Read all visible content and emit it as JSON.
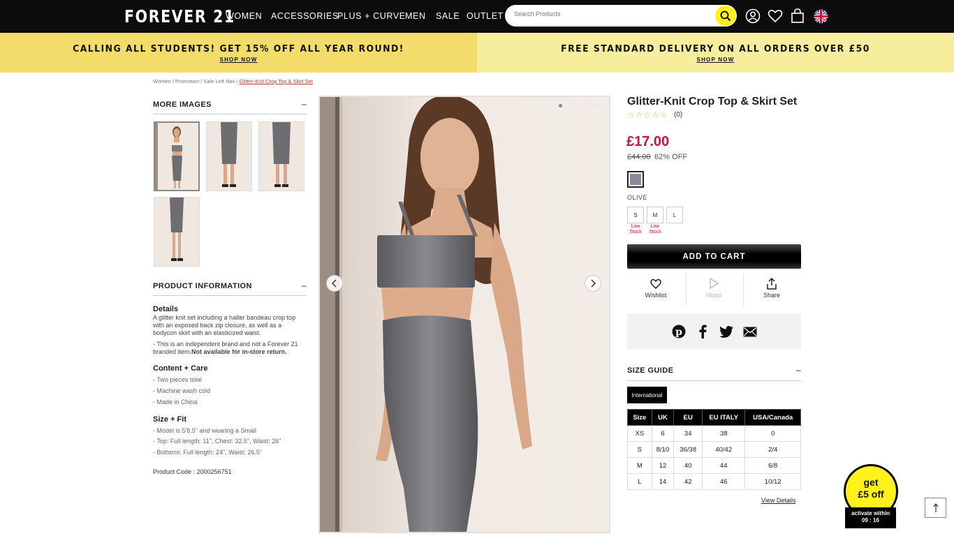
{
  "header": {
    "logo": "FOREVER 21",
    "nav": [
      "WOMEN",
      "ACCESSORIES",
      "PLUS + CURVE",
      "MEN",
      "SALE",
      "OUTLET"
    ],
    "search_placeholder": "Search Products",
    "icons": [
      "search-icon",
      "account-icon",
      "wishlist-heart-icon",
      "shopping-bag-icon",
      "uk-flag-icon"
    ]
  },
  "promos": [
    {
      "text": "CALLING ALL STUDENTS! GET 15% OFF ALL YEAR ROUND!",
      "link": "SHOP NOW",
      "bg": "#f3dc6a"
    },
    {
      "text": "FREE STANDARD DELIVERY ON ALL ORDERS OVER £50",
      "link": "SHOP NOW",
      "bg": "#f6ee9d"
    }
  ],
  "breadcrumb": {
    "path": "Women / Promotion / Sale Left Nav / ",
    "current": "Glitter-Knit Crop Top & Skirt Set"
  },
  "more_images": {
    "title": "MORE IMAGES",
    "toggle": "–"
  },
  "product_info": {
    "title": "PRODUCT INFORMATION",
    "toggle": "–",
    "details_title": "Details",
    "details_text": "A glitter knit set including a halter bandeau crop top with an exposed back zip closure, as well as a bodycon skirt with an elasticized waist.",
    "details_note": "- This is an independent brand and not a Forever 21 branded item.",
    "details_note_bold": "Not available for in-store return.",
    "care_title": "Content + Care",
    "care": [
      "- Two pieces total",
      "- Machine wash cold",
      "- Made in China"
    ],
    "fit_title": "Size + Fit",
    "fit": [
      "- Model is 5'8.5\" and wearing a Small",
      "- Top: Full length: 11\", Chest: 32.5\", Waist: 26\"",
      "- Bottoms: Full length: 24\", Waist: 26.5\""
    ],
    "product_code": "Product Code : 2000256751"
  },
  "product": {
    "title": "Glitter-Knit Crop Top & Skirt Set",
    "stars": "☆☆☆☆☆",
    "rating_count": "(0)",
    "price": "£17.00",
    "old_price": "£44.00",
    "discount": "62% OFF",
    "color": "OLIVE",
    "swatch_color": "#8a8d96",
    "sizes": [
      "S",
      "M",
      "L"
    ],
    "stock": [
      "Low Stock",
      "Low Stock",
      ""
    ],
    "add_to_cart": "ADD TO CART",
    "actions": [
      "Wishlist",
      "Video",
      "Share"
    ],
    "social_icons": [
      "pinterest-icon",
      "facebook-icon",
      "twitter-icon",
      "email-icon"
    ]
  },
  "size_guide": {
    "title": "SIZE GUIDE",
    "toggle": "–",
    "tab": "International",
    "headers": [
      "Size",
      "UK",
      "EU",
      "EU ITALY",
      "USA/Canada"
    ],
    "rows": [
      [
        "XS",
        "6",
        "34",
        "38",
        "0"
      ],
      [
        "S",
        "8/10",
        "36/38",
        "40/42",
        "2/4"
      ],
      [
        "M",
        "12",
        "40",
        "44",
        "6/8"
      ],
      [
        "L",
        "14",
        "42",
        "46",
        "10/12"
      ]
    ],
    "view_details": "View Details"
  },
  "badge": {
    "line1": "get",
    "line2": "£5 off",
    "timer_label": "activate within",
    "timer": "09 : 16"
  },
  "colors": {
    "accent_yellow": "#fff21a",
    "price_red": "#d0103a",
    "header_bg": "#0c0c0c"
  }
}
